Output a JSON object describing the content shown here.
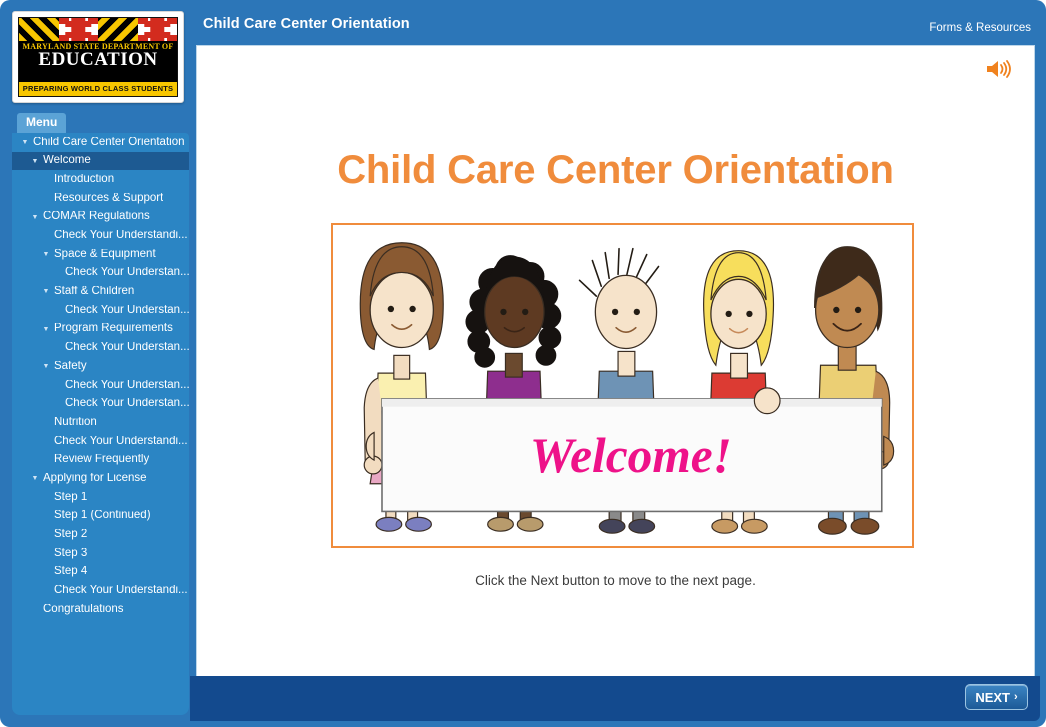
{
  "app": {
    "accent_orange": "#F08C3C",
    "frame_blue": "#2C76B8",
    "panel_blue": "#2B85C4",
    "selected_blue": "#1D5A92",
    "bottom_bar_blue": "#134A8E"
  },
  "logo": {
    "line1": "MARYLAND STATE DEPARTMENT OF",
    "line2": "EDUCATION",
    "tagline": "PREPARING WORLD CLASS STUDENTS"
  },
  "sidebar": {
    "menu_tab_label": "Menu",
    "items": [
      {
        "label": "Child Care Center Orientation",
        "level": 0,
        "caret": true,
        "selected": false
      },
      {
        "label": "Welcome",
        "level": 1,
        "caret": true,
        "selected": true
      },
      {
        "label": "Introduction",
        "level": 2,
        "caret": false,
        "selected": false
      },
      {
        "label": "Resources & Support",
        "level": 2,
        "caret": false,
        "selected": false
      },
      {
        "label": "COMAR Regulations",
        "level": 1,
        "caret": true,
        "selected": false
      },
      {
        "label": "Check Your Understandi...",
        "level": 2,
        "caret": false,
        "selected": false
      },
      {
        "label": "Space & Equipment",
        "level": 2,
        "caret": true,
        "selected": false
      },
      {
        "label": "Check Your Understan...",
        "level": 3,
        "caret": false,
        "selected": false
      },
      {
        "label": "Staff & Children",
        "level": 2,
        "caret": true,
        "selected": false
      },
      {
        "label": "Check Your Understan...",
        "level": 3,
        "caret": false,
        "selected": false
      },
      {
        "label": "Program Requirements",
        "level": 2,
        "caret": true,
        "selected": false
      },
      {
        "label": "Check Your Understan...",
        "level": 3,
        "caret": false,
        "selected": false
      },
      {
        "label": "Safety",
        "level": 2,
        "caret": true,
        "selected": false
      },
      {
        "label": "Check Your Understan...",
        "level": 3,
        "caret": false,
        "selected": false
      },
      {
        "label": "Check Your Understan...",
        "level": 3,
        "caret": false,
        "selected": false
      },
      {
        "label": "Nutrition",
        "level": 2,
        "caret": false,
        "selected": false
      },
      {
        "label": "Check Your Understandi...",
        "level": 2,
        "caret": false,
        "selected": false
      },
      {
        "label": "Review Frequently",
        "level": 2,
        "caret": false,
        "selected": false
      },
      {
        "label": "Applying for License",
        "level": 1,
        "caret": true,
        "selected": false
      },
      {
        "label": "Step 1",
        "level": 2,
        "caret": false,
        "selected": false
      },
      {
        "label": "Step 1 (Continued)",
        "level": 2,
        "caret": false,
        "selected": false
      },
      {
        "label": "Step 2",
        "level": 2,
        "caret": false,
        "selected": false
      },
      {
        "label": "Step 3",
        "level": 2,
        "caret": false,
        "selected": false
      },
      {
        "label": "Step 4",
        "level": 2,
        "caret": false,
        "selected": false
      },
      {
        "label": "Check Your Understandi...",
        "level": 2,
        "caret": false,
        "selected": false
      },
      {
        "label": "Congratulations",
        "level": 1,
        "caret": false,
        "selected": false
      }
    ],
    "caret_glyph": "▼"
  },
  "header": {
    "title": "Child Care Center Orientation",
    "forms_link": "Forms & Resources"
  },
  "slide": {
    "audio_icon": "speaker-icon",
    "title": "Child Care Center Orientation",
    "banner_text": "Welcome!",
    "caption": "Click the Next button to move to the next page."
  },
  "footer": {
    "next_label": "NEXT",
    "next_chevron": "›"
  }
}
